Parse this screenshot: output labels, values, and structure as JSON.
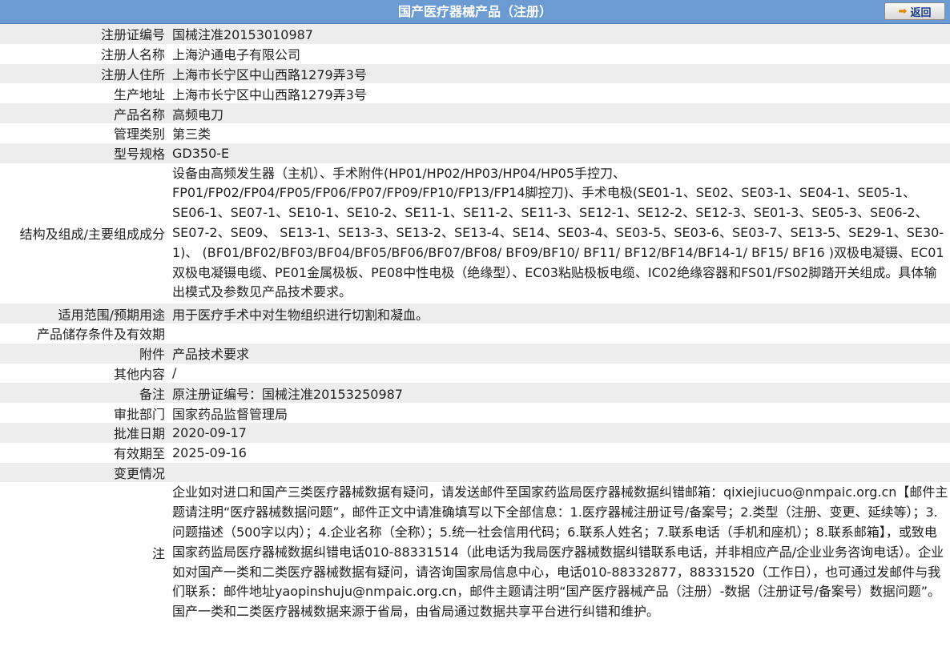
{
  "header": {
    "title": "国产医疗器械产品（注册）",
    "back_label": "返回"
  },
  "rows": [
    {
      "label": "注册证编号",
      "value": "国械注准20153010987"
    },
    {
      "label": "注册人名称",
      "value": "上海沪通电子有限公司"
    },
    {
      "label": "注册人住所",
      "value": "上海市长宁区中山西路1279弄3号"
    },
    {
      "label": "生产地址",
      "value": "上海市长宁区中山西路1279弄3号"
    },
    {
      "label": "产品名称",
      "value": "高频电刀"
    },
    {
      "label": "管理类别",
      "value": "第三类"
    },
    {
      "label": "型号规格",
      "value": "GD350-E"
    },
    {
      "label": "结构及组成/主要组成成分",
      "value": "设备由高频发生器（主机）、手术附件(HP01/HP02/HP03/HP04/HP05手控刀、FP01/FP02/FP04/FP05/FP06/FP07/FP09/FP10/FP13/FP14脚控刀)、手术电极(SE01-1、SE02、SE03-1、SE04-1、SE05-1、SE06-1、SE07-1、SE10-1、SE10-2、SE11-1、SE11-2、SE11-3、SE12-1、SE12-2、SE12-3、SE01-3、SE05-3、SE06-2、SE07-2、SE09、 SE13-1、SE13-3、SE13-2、SE13-4、SE14、SE03-4、SE03-5、SE03-6、SE03-7、SE13-5、SE29-1、SE30-1)、 (BF01/BF02/BF03/BF04/BF05/BF06/BF07/BF08/ BF09/BF10/ BF11/ BF12/BF14/BF14-1/ BF15/ BF16 )双极电凝镊、EC01双极电凝镊电缆、PE01金属极板、PE08中性电极（绝缘型）、EC03粘贴极板电缆、IC02绝缘容器和FS01/FS02脚踏开关组成。具体输出模式及参数见产品技术要求。"
    },
    {
      "label": "适用范围/预期用途",
      "value": "用于医疗手术中对生物组织进行切割和凝血。"
    },
    {
      "label": "产品储存条件及有效期",
      "value": ""
    },
    {
      "label": "附件",
      "value": "产品技术要求"
    },
    {
      "label": "其他内容",
      "value": "/"
    },
    {
      "label": "备注",
      "value": "原注册证编号：国械注准20153250987"
    },
    {
      "label": "审批部门",
      "value": "国家药品监督管理局"
    },
    {
      "label": "批准日期",
      "value": "2020-09-17"
    },
    {
      "label": "有效期至",
      "value": "2025-09-16"
    },
    {
      "label": "变更情况",
      "value": ""
    }
  ],
  "note": {
    "label": "注",
    "text": "企业如对进口和国产三类医疗器械数据有疑问，请发送邮件至国家药监局医疗器械数据纠错邮箱：qixiejiucuo@nmpaic.org.cn【邮件主题请注明“医疗器械数据问题”，邮件正文中请准确填写以下全部信息：1.医疗器械注册证号/备案号；2.类型（注册、变更、延续等）；3.问题描述（500字以内）；4.企业名称（全称）；5.统一社会信用代码；6.联系人姓名；7.联系电话（手机和座机）；8.联系邮箱】，或致电国家药监局医疗器械数据纠错电话010-88331514（此电话为我局医疗器械数据纠错联系电话，并非相应产品/企业业务咨询电话）。企业如对国产一类和二类医疗器械数据有疑问，请咨询国家局信息中心，电话010-88332877，88331520（工作日），也可通过发邮件与我们联系：邮件地址yaopinshuju@nmpaic.org.cn，邮件主题请注明“国产医疗器械产品（注册）-数据（注册证号/备案号）数据问题”。国产一类和二类医疗器械数据来源于省局，由省局通过数据共享平台进行纠错和维护。"
  },
  "colors": {
    "header_bg": "#6b9bd2",
    "row_odd": "#ededed",
    "row_even": "#ffffff"
  }
}
